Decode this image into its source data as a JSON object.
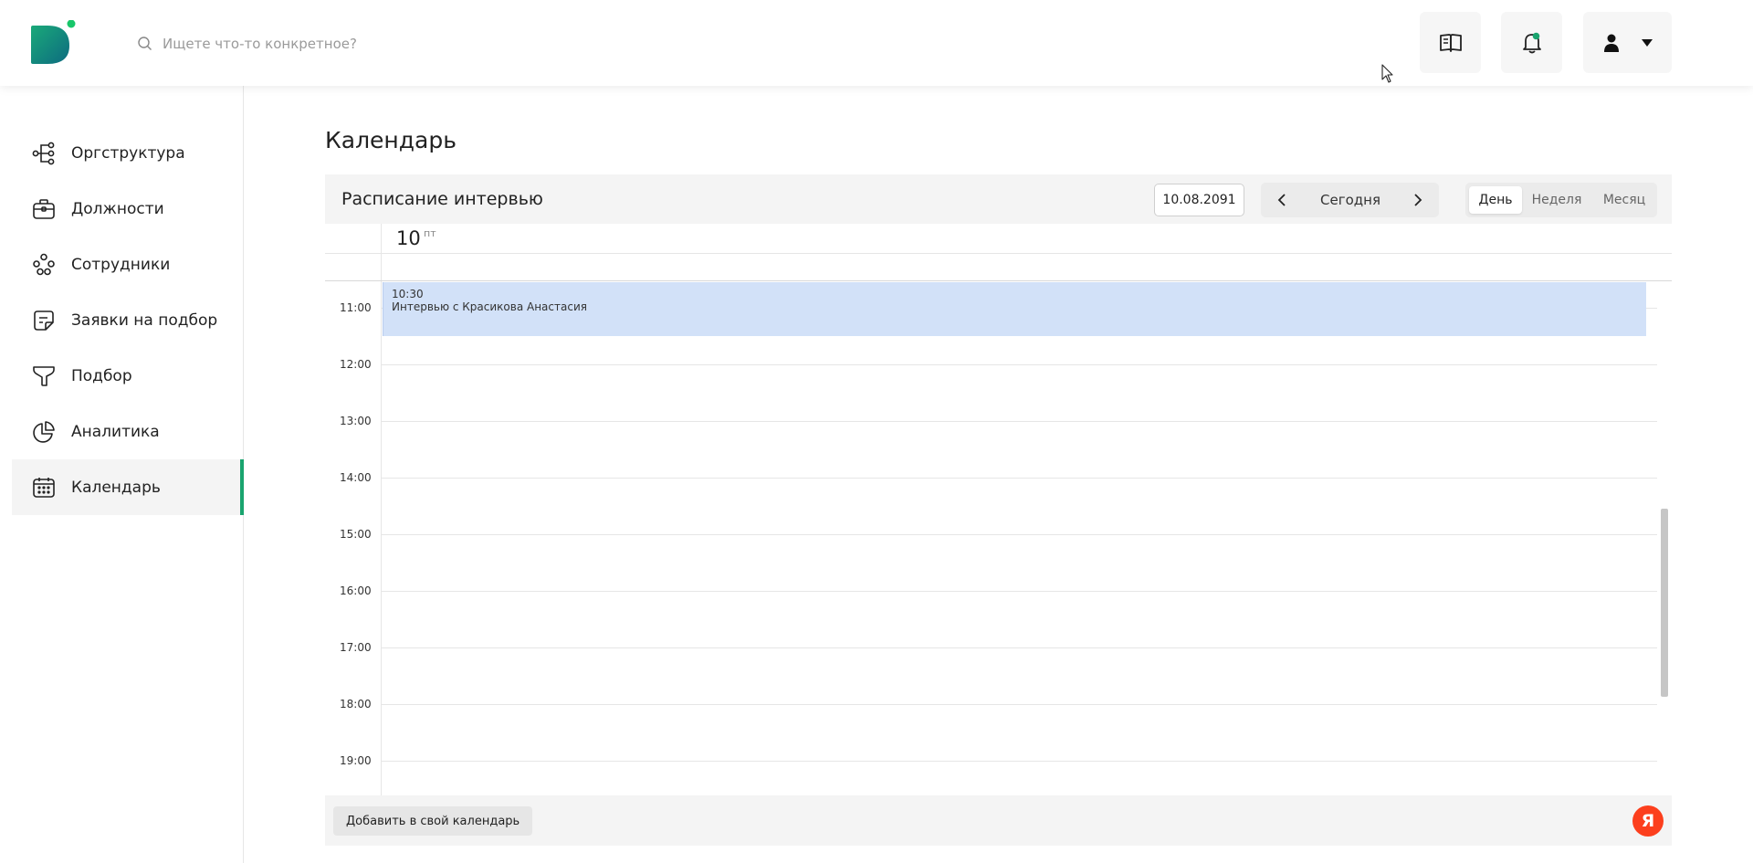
{
  "header": {
    "search_placeholder": "Ищете что-то конкретное?"
  },
  "colors": {
    "brand_green": "#19a46e",
    "event_bg": "#d2e1f8",
    "yandex_red": "#fc3f1d"
  },
  "sidebar": {
    "items": [
      {
        "label": "Оргструктура",
        "icon": "org-structure-icon"
      },
      {
        "label": "Должности",
        "icon": "briefcase-icon"
      },
      {
        "label": "Сотрудники",
        "icon": "people-icon"
      },
      {
        "label": "Заявки на подбор",
        "icon": "document-icon"
      },
      {
        "label": "Подбор",
        "icon": "funnel-icon"
      },
      {
        "label": "Аналитика",
        "icon": "pie-chart-icon"
      },
      {
        "label": "Календарь",
        "icon": "calendar-icon",
        "active": true
      }
    ]
  },
  "main": {
    "title": "Календарь"
  },
  "calendar": {
    "title": "Расписание интервью",
    "date": "10.08.2091",
    "today_label": "Сегодня",
    "views": {
      "day": "День",
      "week": "Неделя",
      "month": "Месяц"
    },
    "active_view": "День",
    "day_number": "10",
    "weekday": "пт",
    "hours": [
      "11:00",
      "12:00",
      "13:00",
      "14:00",
      "15:00",
      "16:00",
      "17:00",
      "18:00",
      "19:00"
    ],
    "event": {
      "time": "10:30",
      "title": "Интервью с Красикова Анастасия"
    },
    "add_button": "Добавить в свой календарь",
    "yandex_letter": "Я"
  }
}
